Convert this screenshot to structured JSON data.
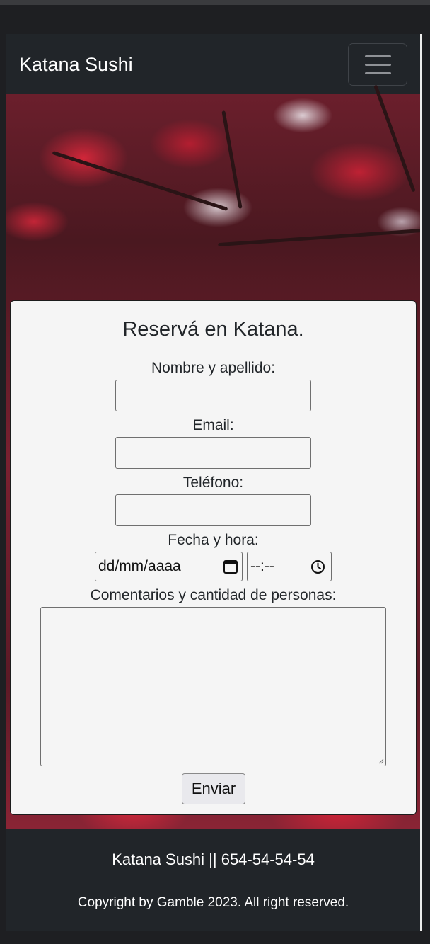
{
  "navbar": {
    "brand": "Katana Sushi",
    "menu_icon": "hamburger-menu-icon"
  },
  "form": {
    "title": "Reservá en Katana.",
    "name_label": "Nombre y apellido:",
    "email_label": "Email:",
    "phone_label": "Teléfono:",
    "datetime_label": "Fecha y hora:",
    "date_placeholder": "dd/mm/aaaa",
    "time_placeholder": "--:--",
    "comments_label": "Comentarios y cantidad de personas:",
    "submit_label": "Enviar"
  },
  "footer": {
    "contact": "Katana Sushi || 654-54-54-54",
    "copyright": "Copyright by Gamble 2023. All right reserved."
  },
  "colors": {
    "navbar_bg": "#212529",
    "card_bg": "#f5f5f5",
    "hero_accent": "#d92a44"
  }
}
